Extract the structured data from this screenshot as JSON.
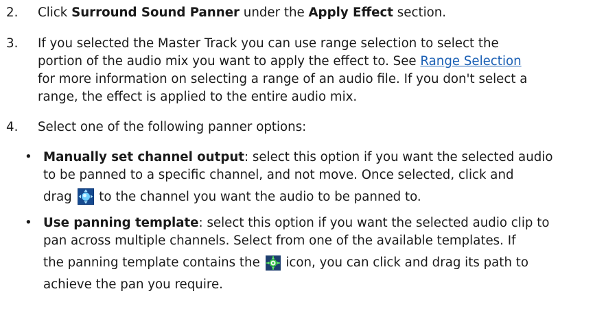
{
  "steps": {
    "step2": {
      "num": "2.",
      "pre": "Click ",
      "bold1": "Surround Sound Panner",
      "mid": " under the ",
      "bold2": "Apply Effect",
      "post": " section."
    },
    "step3": {
      "num": "3.",
      "line1": "If you selected the Master Track you can use range selection to select the",
      "line2_pre": "portion of the audio mix you want to apply the effect to. See ",
      "link": "Range Selection",
      "line3": "for more information on selecting a range of an audio file. If you don't select a",
      "line4": "range, the effect is applied to the entire audio mix."
    },
    "step4": {
      "num": "4.",
      "text": "Select one of the following panner options:"
    }
  },
  "bullets": {
    "manual": {
      "bold": "Manually set channel output",
      "line1_rest": ": select this option if you want the selected audio",
      "line2": "to be panned to a specific channel, and not move. Once selected, click and",
      "line3_pre": "drag ",
      "icon": "surround-panner-puck-icon",
      "line3_post": " to the channel you want the audio to be panned to."
    },
    "template": {
      "bold": "Use panning template",
      "line1_rest": ": select this option if you want the selected audio clip to",
      "line2": "pan across multiple channels. Select from one of the available templates. If",
      "line3_pre": "the panning template contains the ",
      "icon": "path-node-icon",
      "line3_post": " icon, you can click and drag its path to",
      "line4": "achieve the pan you require."
    }
  },
  "bullet_char": "•",
  "colors": {
    "link": "#1a5fb4",
    "puck_light": "#6fd0ff",
    "puck_dark": "#0f3b7a",
    "node_green": "#39c44a"
  }
}
